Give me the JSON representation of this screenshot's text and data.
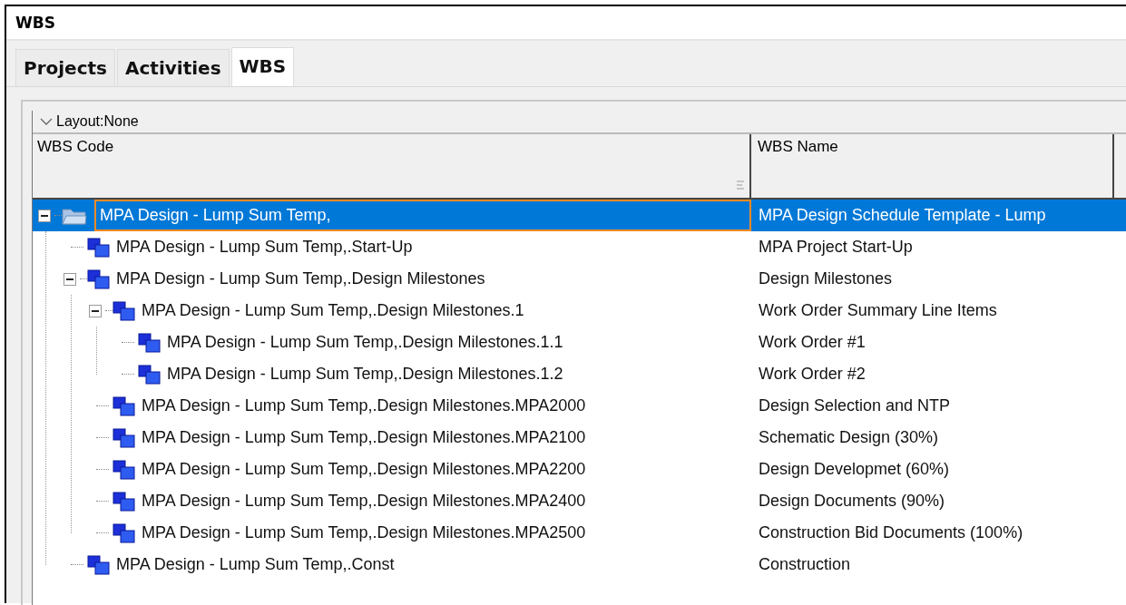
{
  "window": {
    "title": "WBS"
  },
  "tabs": [
    {
      "label": "Projects",
      "selected": false
    },
    {
      "label": "Activities",
      "selected": false
    },
    {
      "label": "WBS",
      "selected": true
    }
  ],
  "layout": {
    "label": "Layout:None"
  },
  "table": {
    "columns": [
      "WBS Code",
      "WBS Name"
    ],
    "rows": [
      {
        "kind": "project",
        "code": "MPA Design - Lump Sum Temp,",
        "name": "MPA Design Schedule Template - Lump",
        "selected": true,
        "expanded": true,
        "children": [
          {
            "kind": "wbs",
            "code": "MPA Design - Lump Sum Temp,.Start-Up",
            "name": "MPA Project Start-Up",
            "selected": false
          },
          {
            "kind": "wbs",
            "code": "MPA Design - Lump Sum Temp,.Design Milestones",
            "name": "Design Milestones",
            "selected": false,
            "expanded": true,
            "children": [
              {
                "kind": "wbs",
                "code": "MPA Design - Lump Sum Temp,.Design Milestones.1",
                "name": "Work Order Summary Line Items",
                "selected": false,
                "expanded": true,
                "children": [
                  {
                    "kind": "wbs",
                    "code": "MPA Design - Lump Sum Temp,.Design Milestones.1.1",
                    "name": "Work Order #1",
                    "selected": false
                  },
                  {
                    "kind": "wbs",
                    "code": "MPA Design - Lump Sum Temp,.Design Milestones.1.2",
                    "name": "Work Order #2",
                    "selected": false
                  }
                ]
              },
              {
                "kind": "wbs",
                "code": "MPA Design - Lump Sum Temp,.Design Milestones.MPA2000",
                "name": "Design Selection and NTP",
                "selected": false
              },
              {
                "kind": "wbs",
                "code": "MPA Design - Lump Sum Temp,.Design Milestones.MPA2100",
                "name": "Schematic Design (30%)",
                "selected": false
              },
              {
                "kind": "wbs",
                "code": "MPA Design - Lump Sum Temp,.Design Milestones.MPA2200",
                "name": "Design Developmet (60%)",
                "selected": false
              },
              {
                "kind": "wbs",
                "code": "MPA Design - Lump Sum Temp,.Design Milestones.MPA2400",
                "name": "Design Documents (90%)",
                "selected": false
              },
              {
                "kind": "wbs",
                "code": "MPA Design - Lump Sum Temp,.Design Milestones.MPA2500",
                "name": "Construction Bid Documents (100%)",
                "selected": false
              }
            ]
          },
          {
            "kind": "wbs",
            "code": "MPA Design - Lump Sum Temp,.Const",
            "name": "Construction",
            "selected": false
          }
        ]
      }
    ]
  }
}
